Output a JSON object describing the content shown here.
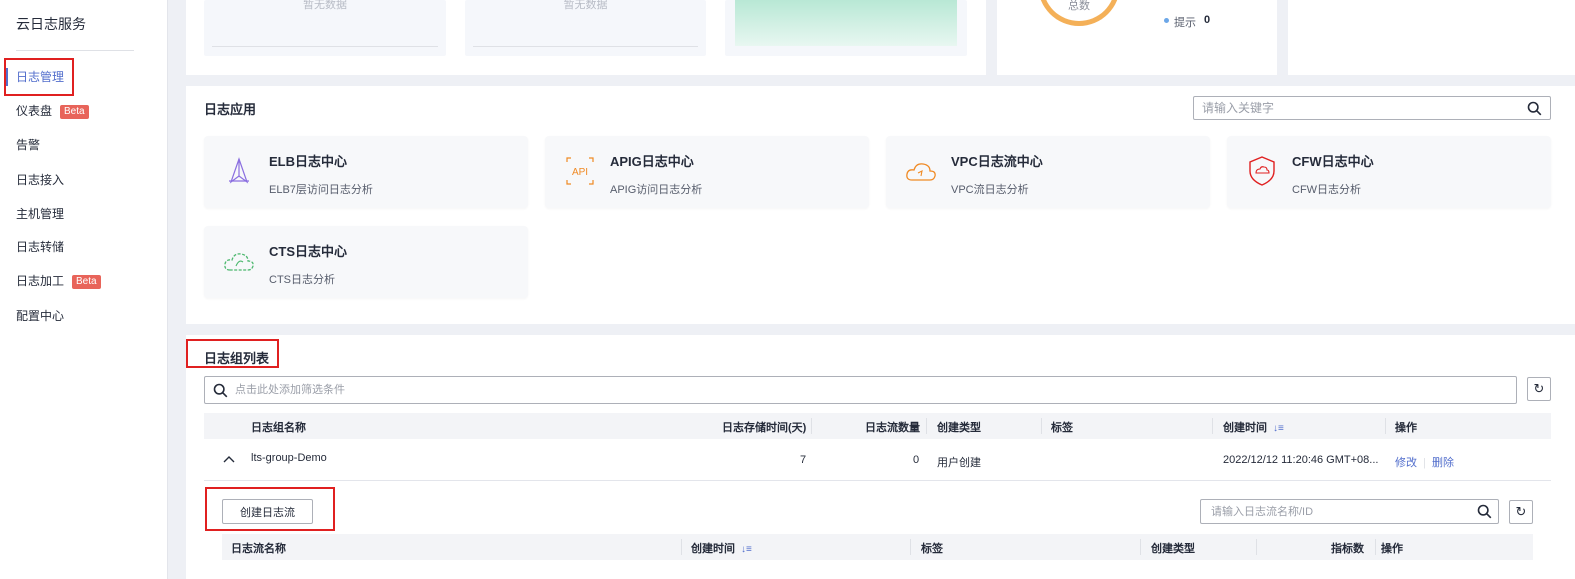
{
  "sidebar": {
    "title": "云日志服务",
    "items": [
      {
        "label": "日志管理",
        "badge": ""
      },
      {
        "label": "仪表盘",
        "badge": "Beta"
      },
      {
        "label": "告警",
        "badge": ""
      },
      {
        "label": "日志接入",
        "badge": ""
      },
      {
        "label": "主机管理",
        "badge": ""
      },
      {
        "label": "日志转储",
        "badge": ""
      },
      {
        "label": "日志加工",
        "badge": "Beta"
      },
      {
        "label": "配置中心",
        "badge": ""
      }
    ]
  },
  "overview": {
    "empty_label_1": "暂无数据",
    "empty_label_2": "暂无数据",
    "donut_label": "总数",
    "legend_label": "提示",
    "legend_value": "0"
  },
  "apps": {
    "title": "日志应用",
    "search_placeholder": "请输入关键字",
    "cards": [
      {
        "name": "ELB日志中心",
        "desc": "ELB7层访问日志分析",
        "icon": "elb-icon"
      },
      {
        "name": "APIG日志中心",
        "desc": "APIG访问日志分析",
        "icon": "apig-icon"
      },
      {
        "name": "VPC日志流中心",
        "desc": "VPC流日志分析",
        "icon": "vpc-cloud-icon"
      },
      {
        "name": "CFW日志中心",
        "desc": "CFW日志分析",
        "icon": "cfw-shield-icon"
      },
      {
        "name": "CTS日志中心",
        "desc": "CTS日志分析",
        "icon": "cts-cloud-icon"
      }
    ]
  },
  "log_groups": {
    "title": "日志组列表",
    "filter_placeholder": "点击此处添加筛选条件",
    "columns": [
      "日志组名称",
      "日志存储时间(天)",
      "日志流数量",
      "创建类型",
      "标签",
      "创建时间",
      "操作"
    ],
    "rows": [
      {
        "name": "lts-group-Demo",
        "retention": "7",
        "stream_count": "0",
        "create_type": "用户创建",
        "tags": "",
        "created": "2022/12/12 11:20:46 GMT+08...",
        "action_edit": "修改",
        "action_delete": "删除"
      }
    ],
    "create_stream_button": "创建日志流",
    "stream_search_placeholder": "请输入日志流名称/ID",
    "stream_columns": [
      "日志流名称",
      "创建时间",
      "标签",
      "创建类型",
      "指标数",
      "操作"
    ]
  }
}
